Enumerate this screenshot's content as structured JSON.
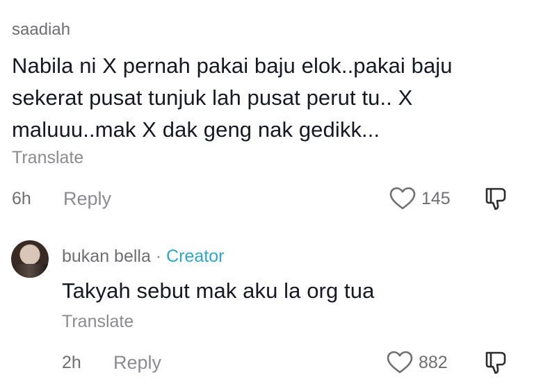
{
  "comments": [
    {
      "username": "saadiah",
      "lines": [
        "Nabila ni X pernah pakai baju elok..pakai baju",
        "sekerat pusat tunjuk lah pusat perut tu.. X",
        "maluuu..mak X dak geng nak gedikk..."
      ],
      "translate_label": "Translate",
      "time": "6h",
      "reply_label": "Reply",
      "like_count": "145",
      "like_icon": "heart-icon",
      "dislike_icon": "thumbs-down-icon"
    },
    {
      "username": "bukan bella",
      "separator": "·",
      "badge": "Creator",
      "text": "Takyah sebut mak aku la org tua",
      "translate_label": "Translate",
      "time": "2h",
      "reply_label": "Reply",
      "like_count": "882",
      "like_icon": "heart-icon",
      "dislike_icon": "thumbs-down-icon"
    }
  ],
  "colors": {
    "primary_text": "#161823",
    "secondary_text": "#8a8b91",
    "creator_accent": "#2fa6c6"
  }
}
